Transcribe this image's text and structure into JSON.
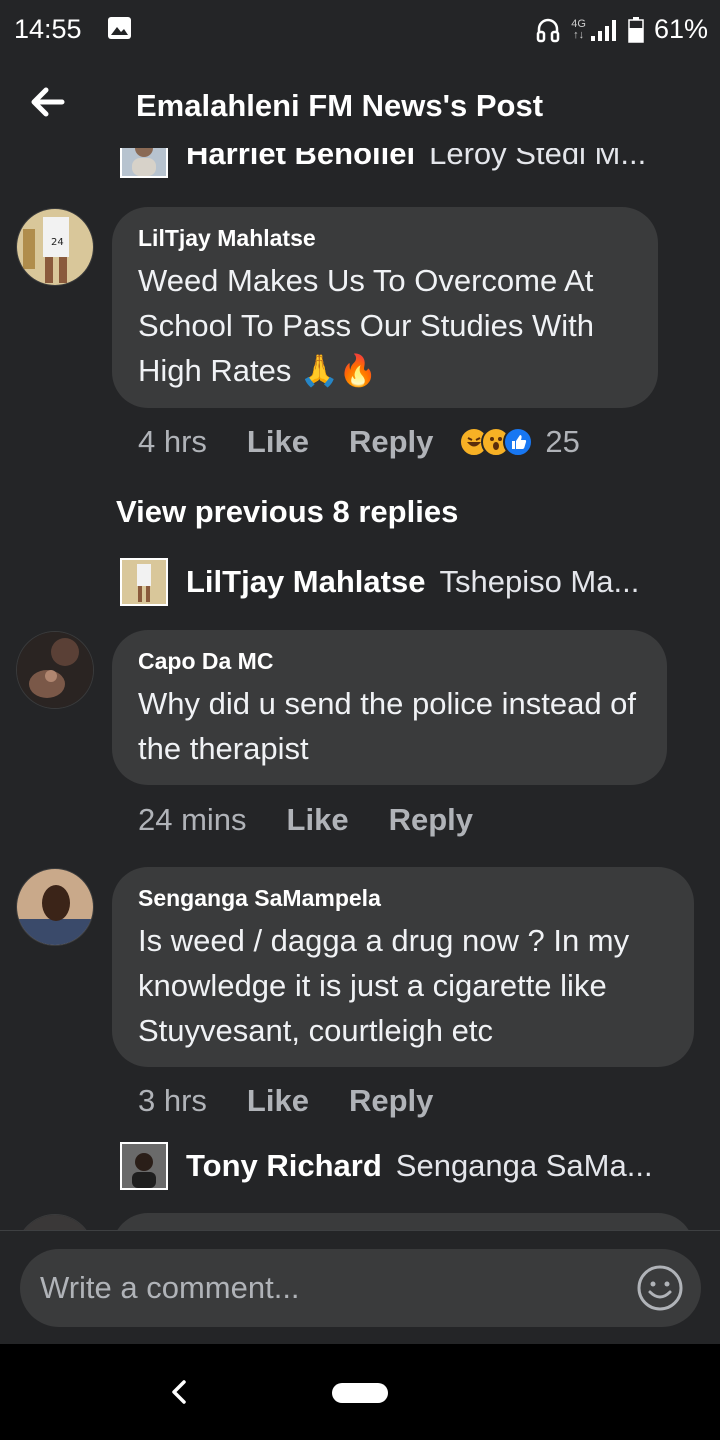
{
  "status_bar": {
    "time": "14:55",
    "network": "4G",
    "battery": "61%"
  },
  "header": {
    "title": "Emalahleni FM News's Post"
  },
  "reply_previews": [
    {
      "name": "Harriet Benoliel",
      "snippet": "Leroy Stedi M..."
    },
    {
      "name": "LilTjay Mahlatse",
      "snippet": "Tshepiso Ma..."
    },
    {
      "name": "Tony Richard",
      "snippet": "Senganga SaMa..."
    }
  ],
  "comments": [
    {
      "author": "LilTjay Mahlatse",
      "text": "Weed Makes Us To Overcome At School To Pass Our Studies With High Rates",
      "emoji": [
        "🙏",
        "🔥"
      ],
      "time": "4 hrs",
      "like": "Like",
      "reply": "Reply",
      "reaction_count": "25",
      "reactions": [
        "haha-icon",
        "wow-icon",
        "like-icon"
      ]
    },
    {
      "author": "Capo Da MC",
      "text": "Why did u send the police instead of the therapist",
      "time": "24 mins",
      "like": "Like",
      "reply": "Reply"
    },
    {
      "author": "Senganga SaMampela",
      "text": "Is weed / dagga a drug now ? In my knowledge it is just a cigarette like Stuyvesant, courtleigh etc",
      "time": "3 hrs",
      "like": "Like",
      "reply": "Reply"
    }
  ],
  "view_previous": "View previous 8 replies",
  "composer": {
    "placeholder": "Write a comment..."
  },
  "colors": {
    "background": "#242527",
    "bubble": "#3a3b3c",
    "secondary_text": "#b0b3b8",
    "like_blue": "#1877f2",
    "haha_yellow": "#f7b125"
  }
}
